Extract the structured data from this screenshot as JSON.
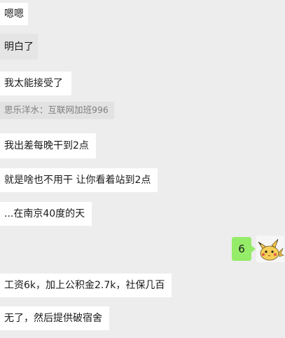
{
  "messages": [
    {
      "text": "嗯嗯"
    },
    {
      "text": "明白了"
    },
    {
      "text": "我太能接受了"
    },
    {
      "text": "我出差每晚干到2点"
    },
    {
      "text": "就是啥也不用干 让你看着站到2点"
    },
    {
      "text": "...在南京40度的天"
    },
    {
      "text": "工资6k，加上公积金2.7k，社保几百"
    },
    {
      "text": "无了，然后提供破宿舍"
    }
  ],
  "quote": {
    "text": "思乐洋水：互联网加班996"
  },
  "sent_message": {
    "text": "6"
  },
  "avatar": {
    "icon": "pikachu-avatar-icon"
  },
  "colors": {
    "background": "#ededed",
    "received_bubble": "#ffffff",
    "sent_bubble": "#95ec69",
    "quote_bg": "#e2e2e2",
    "quote_text": "#7f7f7f"
  }
}
